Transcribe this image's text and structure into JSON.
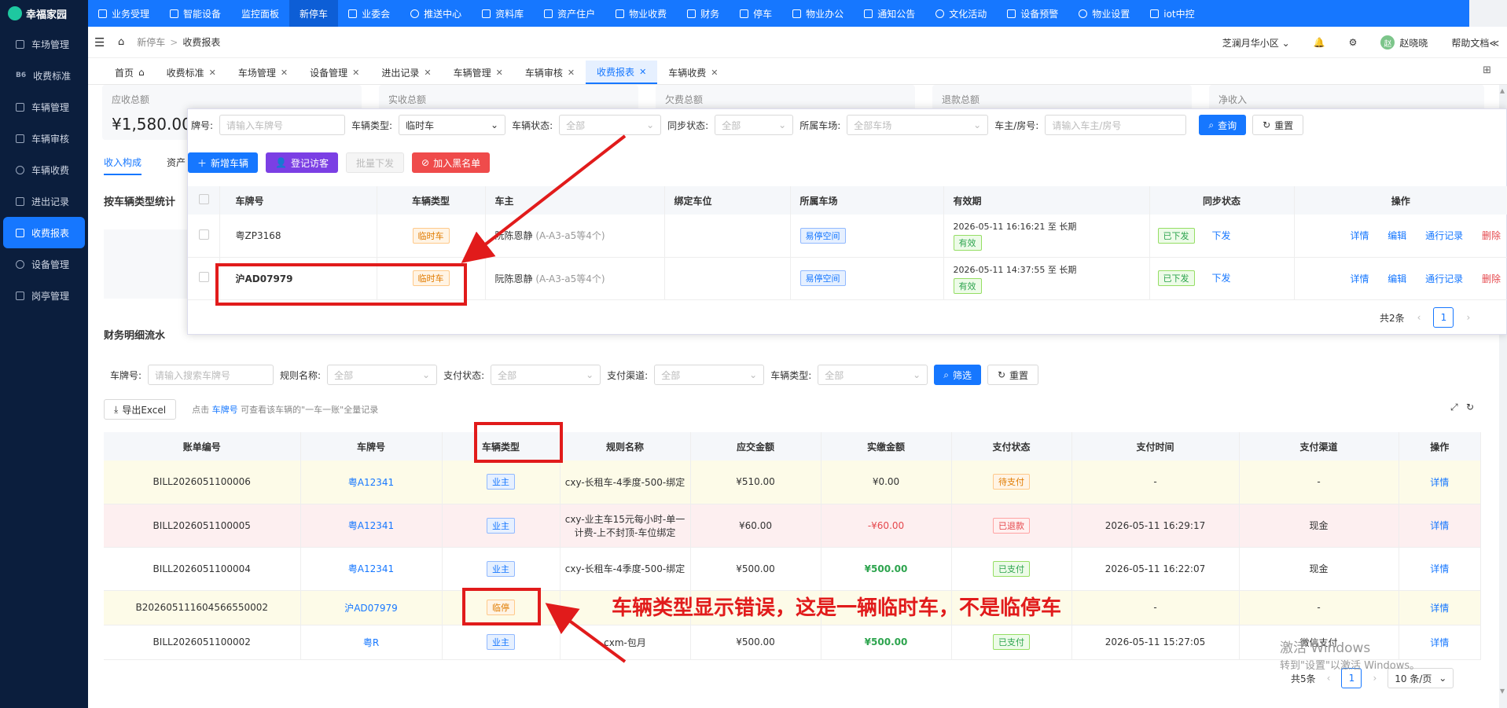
{
  "app": {
    "name": "幸福家园"
  },
  "topnav": [
    {
      "label": "业务受理",
      "icon": "briefcase-icon"
    },
    {
      "label": "智能设备",
      "icon": "device-icon"
    },
    {
      "label": "监控面板",
      "icon": ""
    },
    {
      "label": "新停车",
      "icon": ""
    },
    {
      "label": "业委会",
      "icon": "group-icon"
    },
    {
      "label": "推送中心",
      "icon": "chat-icon"
    },
    {
      "label": "资料库",
      "icon": "doc-icon"
    },
    {
      "label": "资产住户",
      "icon": "home-icon"
    },
    {
      "label": "物业收费",
      "icon": "shield-icon"
    },
    {
      "label": "财务",
      "icon": "ledger-icon"
    },
    {
      "label": "停车",
      "icon": "car-icon"
    },
    {
      "label": "物业办公",
      "icon": "office-icon"
    },
    {
      "label": "通知公告",
      "icon": "megaphone-icon"
    },
    {
      "label": "文化活动",
      "icon": "activity-icon"
    },
    {
      "label": "设备预警",
      "icon": "alert-icon"
    },
    {
      "label": "物业设置",
      "icon": "gear-icon"
    },
    {
      "label": "iot中控",
      "icon": "iot-icon"
    }
  ],
  "sidebar": [
    {
      "label": "车场管理"
    },
    {
      "label": "收费标准",
      "prefix": "B6"
    },
    {
      "label": "车辆管理"
    },
    {
      "label": "车辆审核"
    },
    {
      "label": "车辆收费"
    },
    {
      "label": "进出记录"
    },
    {
      "label": "收费报表"
    },
    {
      "label": "设备管理"
    },
    {
      "label": "岗亭管理"
    }
  ],
  "breadcrumb": {
    "first": "新停车",
    "sep": ">",
    "second": "收费报表"
  },
  "header": {
    "community": "芝澜月华小区",
    "user": "赵晓晓",
    "user_initial": "赵",
    "help": "帮助文档"
  },
  "tabs": [
    {
      "label": "首页"
    },
    {
      "label": "收费标准"
    },
    {
      "label": "车场管理"
    },
    {
      "label": "设备管理"
    },
    {
      "label": "进出记录"
    },
    {
      "label": "车辆管理"
    },
    {
      "label": "车辆审核"
    },
    {
      "label": "收费报表"
    },
    {
      "label": "车辆收费"
    }
  ],
  "stats": [
    {
      "label": "应收总额",
      "value": "¥1,580.00"
    },
    {
      "label": "实收总额",
      "value": ""
    },
    {
      "label": "欠费总额",
      "value": ""
    },
    {
      "label": "退款总额",
      "value": ""
    },
    {
      "label": "净收入",
      "value": ""
    }
  ],
  "subtabs": {
    "first": "收入构成",
    "second": "资产"
  },
  "section1_title": "按车辆类型统计",
  "section2_title": "财务明细流水",
  "filters": {
    "plate_label": "车牌号:",
    "plate_placeholder": "请输入搜索车牌号",
    "rule_label": "规则名称:",
    "rule_value": "全部",
    "pay_label": "支付状态:",
    "pay_value": "全部",
    "channel_label": "支付渠道:",
    "channel_value": "全部",
    "type_label": "车辆类型:",
    "type_value": "全部",
    "filter_btn": "筛选",
    "reset_btn": "重置"
  },
  "export": {
    "label": "导出Excel",
    "hint_a": "点击",
    "hint_link": "车牌号",
    "hint_b": "可查看该车辆的\"一车一账\"全量记录"
  },
  "finance_table": {
    "headers": [
      "账单编号",
      "车牌号",
      "车辆类型",
      "规则名称",
      "应交金额",
      "实缴金额",
      "支付状态",
      "支付时间",
      "支付渠道",
      "操作"
    ],
    "rows": [
      {
        "bill": "BILL2026051100006",
        "plate": "粤A12341",
        "type": "业主",
        "rule": "cxy-长租车-4季度-500-绑定",
        "due": "¥510.00",
        "paid": "¥0.00",
        "status": "待支付",
        "time": "-",
        "channel": "-",
        "op": "详情",
        "bg": "yellow"
      },
      {
        "bill": "BILL2026051100005",
        "plate": "粤A12341",
        "type": "业主",
        "rule": "cxy-业主车15元每小时-单一计费-上不封顶-车位绑定",
        "due": "¥60.00",
        "paid": "-¥60.00",
        "status": "已退款",
        "time": "2026-05-11 16:29:17",
        "channel": "现金",
        "op": "详情",
        "bg": "pink"
      },
      {
        "bill": "BILL2026051100004",
        "plate": "粤A12341",
        "type": "业主",
        "rule": "cxy-长租车-4季度-500-绑定",
        "due": "¥500.00",
        "paid": "¥500.00",
        "status": "已支付",
        "time": "2026-05-11 16:22:07",
        "channel": "现金",
        "op": "详情",
        "bg": "white"
      },
      {
        "bill": "B2026051116045665500​02",
        "plate": "沪AD07979",
        "type": "临停",
        "rule": "",
        "due": "",
        "paid": "",
        "status": "",
        "time": "-",
        "channel": "-",
        "op": "详情",
        "bg": "yellow"
      },
      {
        "bill": "BILL2026051100002",
        "plate": "粤R",
        "type": "业主",
        "rule": "cxm-包月",
        "due": "¥500.00",
        "paid": "¥500.00",
        "status": "已支付",
        "time": "2026-05-11 15:27:05",
        "channel": "微信支付",
        "op": "详情",
        "bg": "white"
      }
    ]
  },
  "pager": {
    "total": "共5条",
    "page": "1",
    "size": "10 条/页"
  },
  "overlay": {
    "search": {
      "plate_label": "牌号:",
      "plate_placeholder": "请输入车牌号",
      "type_label": "车辆类型:",
      "type_value": "临时车",
      "state_label": "车辆状态:",
      "state_value": "全部",
      "sync_label": "同步状态:",
      "sync_value": "全部",
      "lot_label": "所属车场:",
      "lot_value": "全部车场",
      "owner_label": "车主/房号:",
      "owner_placeholder": "请输入车主/房号",
      "query_btn": "查询",
      "reset_btn": "重置"
    },
    "actions": {
      "add": "新增车辆",
      "visitor": "登记访客",
      "batch": "批量下发",
      "blacklist": "加入黑名单"
    },
    "headers": [
      "车牌号",
      "车辆类型",
      "车主",
      "绑定车位",
      "所属车场",
      "有效期",
      "同步状态",
      "操作"
    ],
    "rows": [
      {
        "plate": "粤ZP3168",
        "type": "临时车",
        "owner": "阮陈恩静",
        "owner_note": "(A-A3-a5等4个)",
        "spot": "",
        "lot": "易停空间",
        "valid": "2026-05-11 16:16:21 至 长期",
        "valid_tag": "有效",
        "sync": "已下发",
        "sync_btn": "下发",
        "ops": [
          "详情",
          "编辑",
          "通行记录",
          "删除"
        ]
      },
      {
        "plate": "沪AD07979",
        "type": "临时车",
        "owner": "阮陈恩静",
        "owner_note": "(A-A3-a5等4个)",
        "spot": "",
        "lot": "易停空间",
        "valid": "2026-05-11 14:37:55 至 长期",
        "valid_tag": "有效",
        "sync": "已下发",
        "sync_btn": "下发",
        "ops": [
          "详情",
          "编辑",
          "通行记录",
          "删除"
        ]
      }
    ],
    "pager": {
      "total": "共2条",
      "page": "1"
    }
  },
  "annotation": "车辆类型显示错误，这是一辆临时车，不是临停车",
  "windows_watermark": {
    "line1": "激活 Windows",
    "line2": "转到\"设置\"以激活 Windows。"
  },
  "colors": {
    "primary": "#1677ff",
    "sidebar": "#0b1e3d",
    "annotation": "#e11b1b"
  }
}
